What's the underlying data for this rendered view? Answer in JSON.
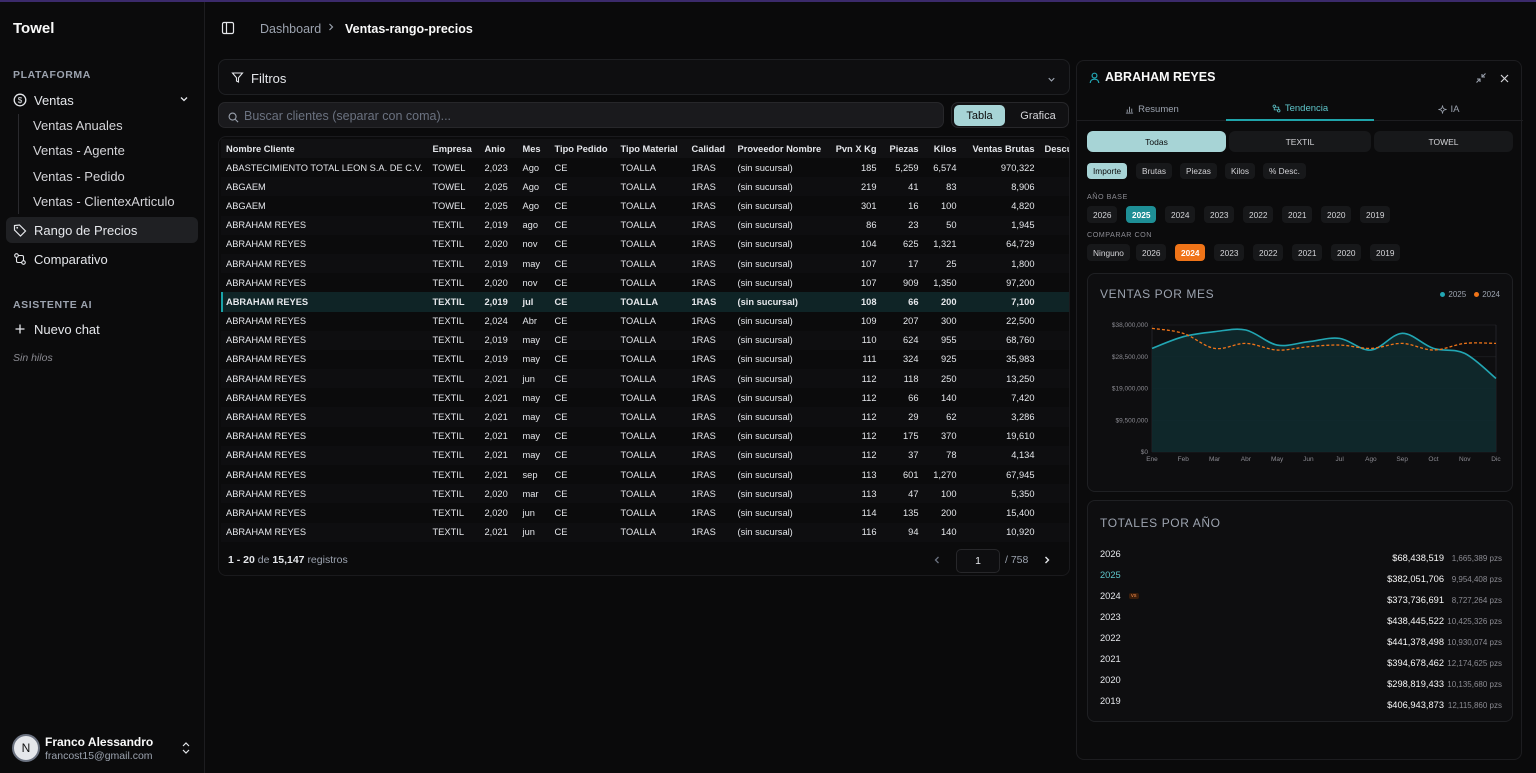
{
  "app": {
    "name": "Towel"
  },
  "sidebar": {
    "section_platform": "PLATAFORMA",
    "ventas_label": "Ventas",
    "sub_items": [
      "Ventas Anuales",
      "Ventas - Agente",
      "Ventas - Pedido",
      "Ventas - ClientexArticulo"
    ],
    "rango_label": "Rango de Precios",
    "comparativo_label": "Comparativo",
    "section_ai": "ASISTENTE AI",
    "nuevo_chat": "Nuevo chat",
    "sin_hilos": "Sin hilos",
    "user": {
      "initial": "N",
      "name": "Franco Alessandro",
      "email": "francost15@gmail.com"
    }
  },
  "header": {
    "crumb_root": "Dashboard",
    "crumb_current": "Ventas-rango-precios"
  },
  "filters": {
    "label": "Filtros"
  },
  "search": {
    "placeholder": "Buscar clientes (separar con coma)..."
  },
  "view_toggle": {
    "table": "Tabla",
    "chart": "Grafica"
  },
  "table": {
    "columns": [
      "Nombre Cliente",
      "Empresa",
      "Anio",
      "Mes",
      "Tipo Pedido",
      "Tipo Material",
      "Calidad",
      "Proveedor Nombre",
      "Pvn X Kg",
      "Piezas",
      "Kilos",
      "Ventas Brutas",
      "Descue"
    ],
    "rows": [
      [
        "ABASTECIMIENTO TOTAL LEON S.A. DE C.V.",
        "TOWEL",
        "2,023",
        "Ago",
        "CE",
        "TOALLA",
        "1RAS",
        "(sin sucursal)",
        "185",
        "5,259",
        "6,574",
        "970,322",
        ""
      ],
      [
        "ABGAEM",
        "TOWEL",
        "2,025",
        "Ago",
        "CE",
        "TOALLA",
        "1RAS",
        "(sin sucursal)",
        "219",
        "41",
        "83",
        "8,906",
        ""
      ],
      [
        "ABGAEM",
        "TOWEL",
        "2,025",
        "Ago",
        "CE",
        "TOALLA",
        "1RAS",
        "(sin sucursal)",
        "301",
        "16",
        "100",
        "4,820",
        ""
      ],
      [
        "ABRAHAM REYES",
        "TEXTIL",
        "2,019",
        "ago",
        "CE",
        "TOALLA",
        "1RAS",
        "(sin sucursal)",
        "86",
        "23",
        "50",
        "1,945",
        ""
      ],
      [
        "ABRAHAM REYES",
        "TEXTIL",
        "2,020",
        "nov",
        "CE",
        "TOALLA",
        "1RAS",
        "(sin sucursal)",
        "104",
        "625",
        "1,321",
        "64,729",
        ""
      ],
      [
        "ABRAHAM REYES",
        "TEXTIL",
        "2,019",
        "may",
        "CE",
        "TOALLA",
        "1RAS",
        "(sin sucursal)",
        "107",
        "17",
        "25",
        "1,800",
        ""
      ],
      [
        "ABRAHAM REYES",
        "TEXTIL",
        "2,020",
        "nov",
        "CE",
        "TOALLA",
        "1RAS",
        "(sin sucursal)",
        "107",
        "909",
        "1,350",
        "97,200",
        ""
      ],
      [
        "ABRAHAM REYES",
        "TEXTIL",
        "2,019",
        "jul",
        "CE",
        "TOALLA",
        "1RAS",
        "(sin sucursal)",
        "108",
        "66",
        "200",
        "7,100",
        ""
      ],
      [
        "ABRAHAM REYES",
        "TEXTIL",
        "2,024",
        "Abr",
        "CE",
        "TOALLA",
        "1RAS",
        "(sin sucursal)",
        "109",
        "207",
        "300",
        "22,500",
        ""
      ],
      [
        "ABRAHAM REYES",
        "TEXTIL",
        "2,019",
        "may",
        "CE",
        "TOALLA",
        "1RAS",
        "(sin sucursal)",
        "110",
        "624",
        "955",
        "68,760",
        ""
      ],
      [
        "ABRAHAM REYES",
        "TEXTIL",
        "2,019",
        "may",
        "CE",
        "TOALLA",
        "1RAS",
        "(sin sucursal)",
        "111",
        "324",
        "925",
        "35,983",
        ""
      ],
      [
        "ABRAHAM REYES",
        "TEXTIL",
        "2,021",
        "jun",
        "CE",
        "TOALLA",
        "1RAS",
        "(sin sucursal)",
        "112",
        "118",
        "250",
        "13,250",
        ""
      ],
      [
        "ABRAHAM REYES",
        "TEXTIL",
        "2,021",
        "may",
        "CE",
        "TOALLA",
        "1RAS",
        "(sin sucursal)",
        "112",
        "66",
        "140",
        "7,420",
        ""
      ],
      [
        "ABRAHAM REYES",
        "TEXTIL",
        "2,021",
        "may",
        "CE",
        "TOALLA",
        "1RAS",
        "(sin sucursal)",
        "112",
        "29",
        "62",
        "3,286",
        ""
      ],
      [
        "ABRAHAM REYES",
        "TEXTIL",
        "2,021",
        "may",
        "CE",
        "TOALLA",
        "1RAS",
        "(sin sucursal)",
        "112",
        "175",
        "370",
        "19,610",
        ""
      ],
      [
        "ABRAHAM REYES",
        "TEXTIL",
        "2,021",
        "may",
        "CE",
        "TOALLA",
        "1RAS",
        "(sin sucursal)",
        "112",
        "37",
        "78",
        "4,134",
        ""
      ],
      [
        "ABRAHAM REYES",
        "TEXTIL",
        "2,021",
        "sep",
        "CE",
        "TOALLA",
        "1RAS",
        "(sin sucursal)",
        "113",
        "601",
        "1,270",
        "67,945",
        ""
      ],
      [
        "ABRAHAM REYES",
        "TEXTIL",
        "2,020",
        "mar",
        "CE",
        "TOALLA",
        "1RAS",
        "(sin sucursal)",
        "113",
        "47",
        "100",
        "5,350",
        ""
      ],
      [
        "ABRAHAM REYES",
        "TEXTIL",
        "2,020",
        "jun",
        "CE",
        "TOALLA",
        "1RAS",
        "(sin sucursal)",
        "114",
        "135",
        "200",
        "15,400",
        ""
      ],
      [
        "ABRAHAM REYES",
        "TEXTIL",
        "2,021",
        "jun",
        "CE",
        "TOALLA",
        "1RAS",
        "(sin sucursal)",
        "116",
        "94",
        "140",
        "10,920",
        ""
      ]
    ],
    "selected_row": 7
  },
  "pagination": {
    "range": "1 - 20",
    "de": "de",
    "total": "15,147",
    "registros": "registros",
    "page": "1",
    "of_pages": "/ 758"
  },
  "panel": {
    "title": "ABRAHAM REYES",
    "tabs": [
      "Resumen",
      "Tendencia",
      "IA"
    ],
    "active_tab": "Tendencia",
    "company_seg": [
      "Todas",
      "TEXTIL",
      "TOWEL"
    ],
    "metrics": [
      "Importe",
      "Brutas",
      "Piezas",
      "Kilos",
      "% Desc."
    ],
    "base_label": "AÑO BASE",
    "base_years": [
      "2026",
      "2025",
      "2024",
      "2023",
      "2022",
      "2021",
      "2020",
      "2019"
    ],
    "compare_label": "COMPARAR CON",
    "compare_years": [
      "Ninguno",
      "2026",
      "2024",
      "2023",
      "2022",
      "2021",
      "2020",
      "2019"
    ],
    "chart_title": "VENTAS POR MES",
    "totals_title": "TOTALES POR AÑO",
    "vs_badge": "vs",
    "totals": [
      {
        "year": "2026",
        "amount": "$68,438,519",
        "pzs": "1,665,389 pzs"
      },
      {
        "year": "2025",
        "amount": "$382,051,706",
        "pzs": "9,954,408 pzs"
      },
      {
        "year": "2024",
        "amount": "$373,736,691",
        "pzs": "8,727,264 pzs"
      },
      {
        "year": "2023",
        "amount": "$438,445,522",
        "pzs": "10,425,326 pzs"
      },
      {
        "year": "2022",
        "amount": "$441,378,498",
        "pzs": "10,930,074 pzs"
      },
      {
        "year": "2021",
        "amount": "$394,678,462",
        "pzs": "12,174,625 pzs"
      },
      {
        "year": "2020",
        "amount": "$298,819,433",
        "pzs": "10,135,680 pzs"
      },
      {
        "year": "2019",
        "amount": "$406,943,873",
        "pzs": "12,115,860 pzs"
      }
    ]
  },
  "chart_data": {
    "type": "area",
    "title": "VENTAS POR MES",
    "categories": [
      "Ene",
      "Feb",
      "Mar",
      "Abr",
      "May",
      "Jun",
      "Jul",
      "Ago",
      "Sep",
      "Oct",
      "Nov",
      "Dic"
    ],
    "y_ticks": [
      "$0",
      "$9,500,000",
      "$19,000,000",
      "$28,500,000",
      "$38,000,000"
    ],
    "ylim": [
      0,
      38000000
    ],
    "series": [
      {
        "name": "2025",
        "color": "#22a6b3",
        "values": [
          31000000,
          34500000,
          36000000,
          36500000,
          32000000,
          33000000,
          34000000,
          30500000,
          35500000,
          31000000,
          29500000,
          22000000
        ]
      },
      {
        "name": "2024",
        "color": "#f07418",
        "values": [
          37000000,
          35500000,
          31000000,
          32500000,
          30500000,
          31500000,
          32000000,
          31000000,
          32500000,
          30500000,
          32500000,
          32500000
        ]
      }
    ],
    "legend": "top-right"
  }
}
